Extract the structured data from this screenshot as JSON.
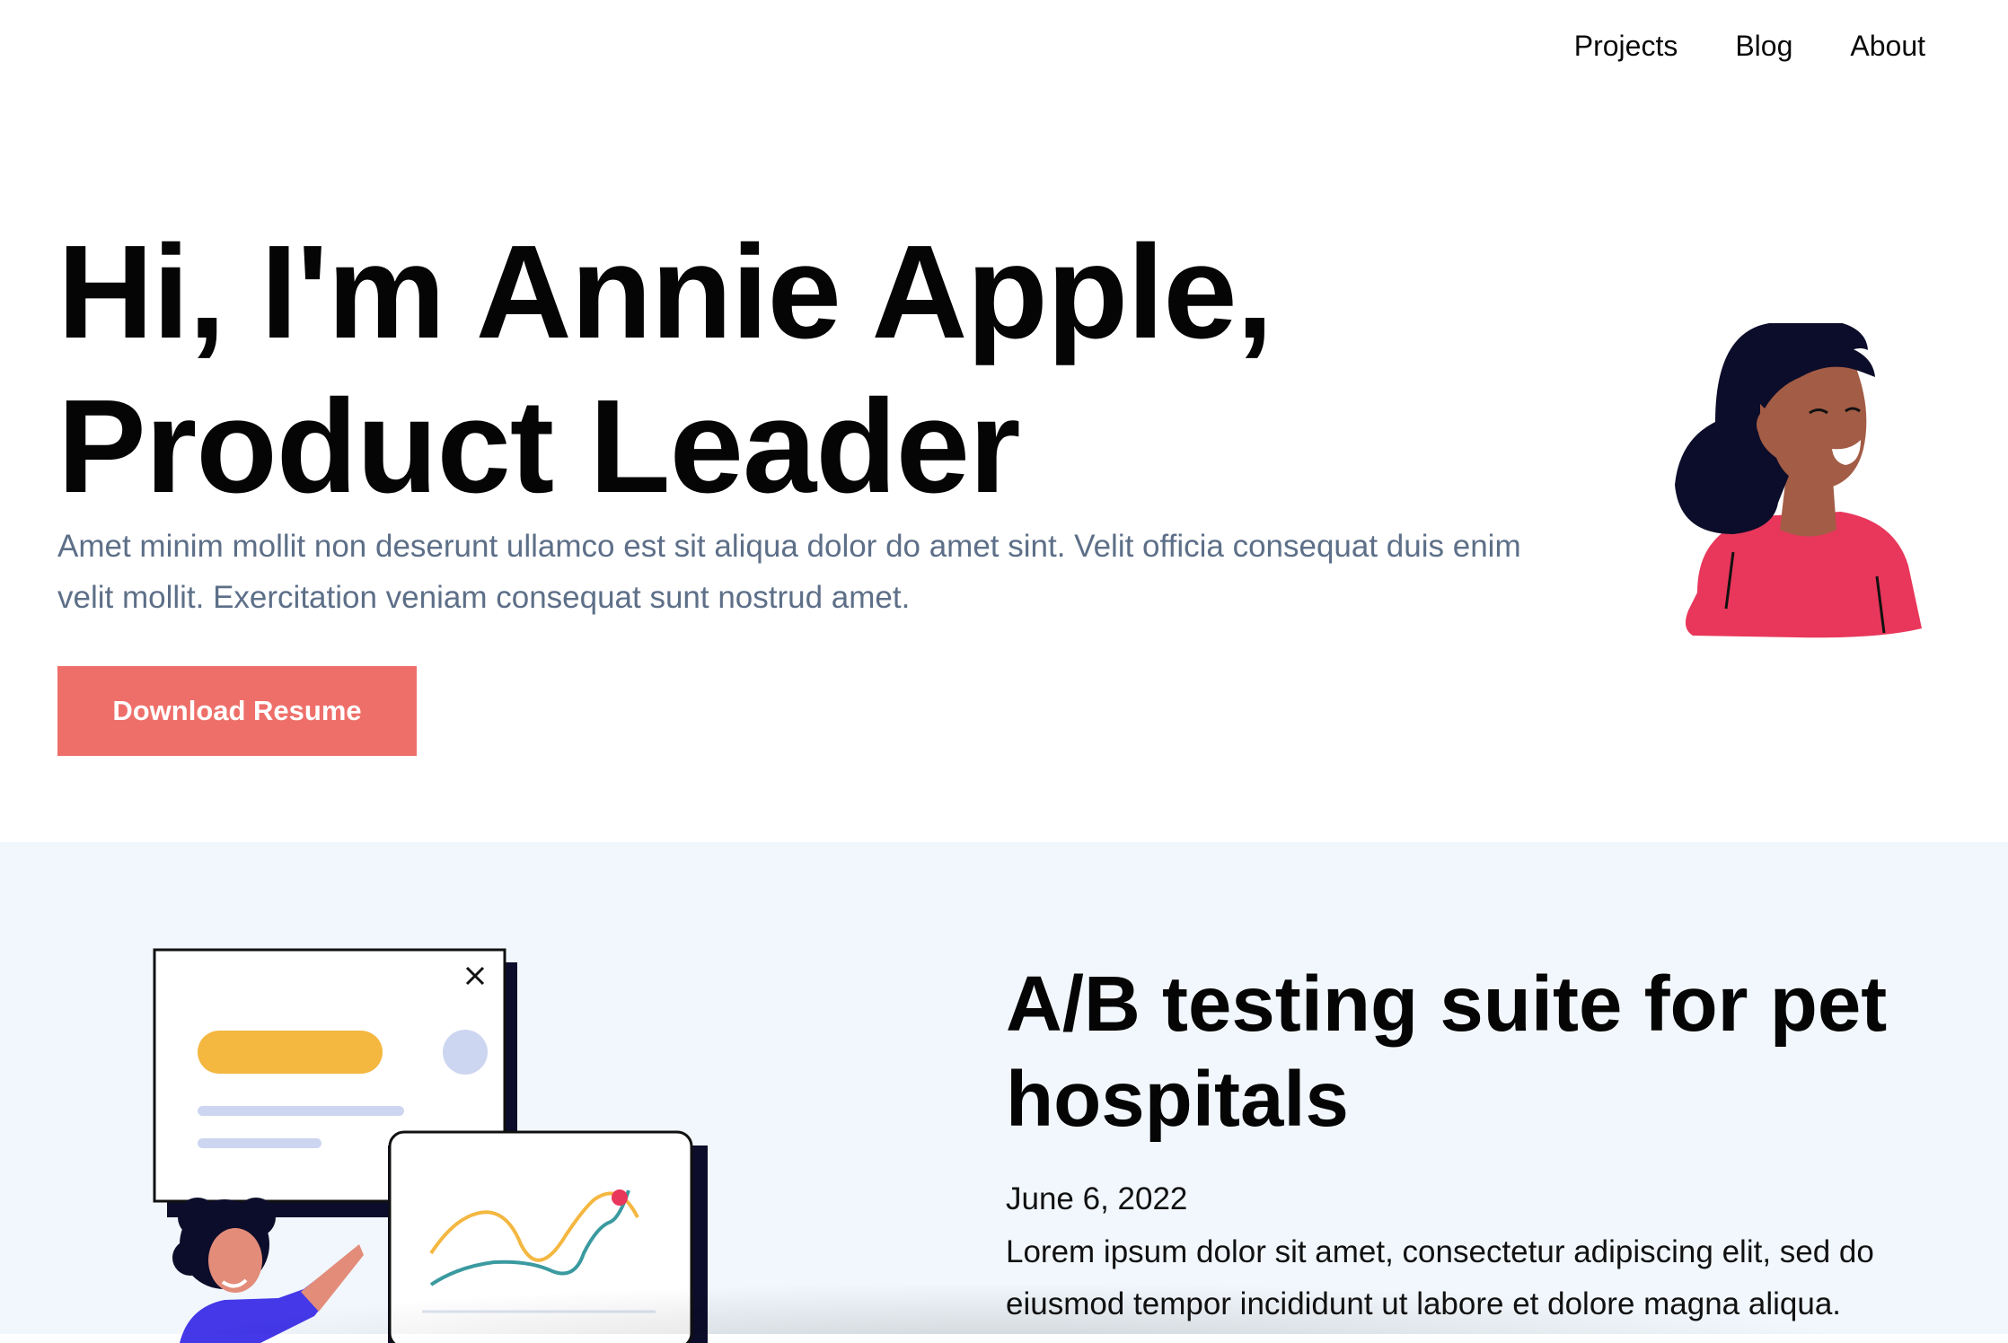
{
  "nav": {
    "items": [
      {
        "label": "Projects"
      },
      {
        "label": "Blog"
      },
      {
        "label": "About"
      }
    ]
  },
  "hero": {
    "title_line1": "Hi, I'm Annie Apple,",
    "title_line2": "Product Leader",
    "description": "Amet minim mollit non deserunt ullamco est sit aliqua dolor do amet sint. Velit officia consequat duis enim velit mollit. Exercitation veniam consequat sunt nostrud amet.",
    "cta_label": "Download Resume"
  },
  "project": {
    "title": "A/B testing suite for pet hospitals",
    "date": "June 6, 2022",
    "text": "Lorem ipsum dolor sit amet, consectetur adipiscing elit, sed do eiusmod tempor incididunt ut labore et dolore magna aliqua."
  },
  "colors": {
    "accent": "#ee6f6a",
    "description_text": "#5d6f88",
    "section_bg": "#f1f7fc",
    "avatar_shirt": "#e8375b",
    "illus_yellow": "#f4b740",
    "illus_teal": "#3a9aa0",
    "illus_blue": "#4438e8"
  }
}
